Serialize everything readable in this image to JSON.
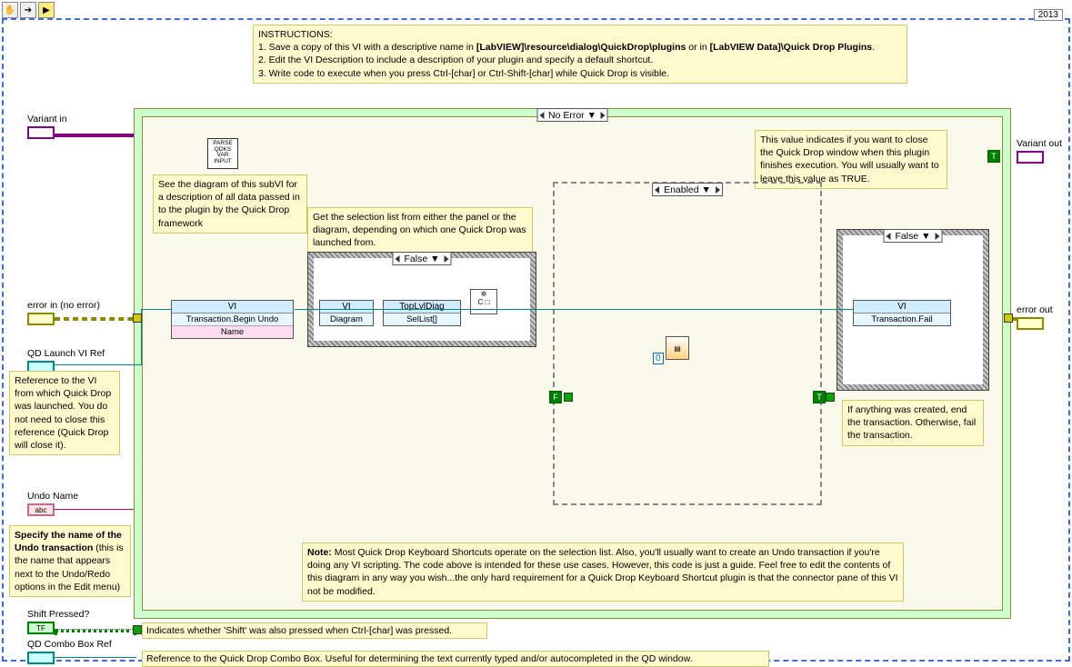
{
  "toolbar": {
    "hand": "✋",
    "arrow": "➔",
    "run": "▶"
  },
  "year": "2013",
  "instructions": {
    "heading": "INSTRUCTIONS:",
    "line1a": "1.  Save a copy of this VI with a descriptive name in ",
    "path1": "[LabVIEW]\\resource\\dialog\\QuickDrop\\plugins",
    "line1b": " or in ",
    "path2": "[LabVIEW Data]\\Quick Drop Plugins",
    "line2": "2.  Edit the VI Description to include a description of your plugin and specify a default shortcut.",
    "line3": "3.  Write code to execute when you press Ctrl-[char] or Ctrl-Shift-[char] while Quick Drop is visible."
  },
  "controls": {
    "variantIn": "Variant in",
    "variantOut": "Variant out",
    "errorIn": "error in (no error)",
    "errorOut": "error out",
    "qdLaunch": "QD Launch VI Ref",
    "undoName": "Undo Name",
    "shiftPressed": "Shift Pressed?",
    "qdCombo": "QD Combo Box Ref"
  },
  "comments": {
    "parseNote": "See the diagram of this subVI for a description of all data passed in to the plugin by the Quick Drop framework",
    "closeNote": "This value indicates if you want to close the Quick Drop window when this plugin finishes execution.  You will usually want to leave this value as TRUE.",
    "launchRef": "Reference to the VI from which Quick Drop was launched.  You do not need to close this reference (Quick Drop will close it).",
    "undoNote": {
      "bold": "Specify the name of the Undo transaction",
      "rest": " (this is the name that appears next to the Undo/Redo options in the Edit menu)"
    },
    "bottomNote": {
      "bold": "Note:",
      "rest": "  Most Quick Drop Keyboard Shortcuts operate on the selection list.  Also, you'll usually want to create an Undo transaction if you're doing any VI scripting.  The code above is intended for these use cases.  However, this code is just a guide.  Feel free to edit the contents of this diagram in any way you wish...the only hard requirement for a Quick Drop Keyboard Shortcut plugin is that the connector pane of this VI not be modified."
    },
    "selNote": "Get the selection list from either the panel or the diagram, depending on which one Quick Drop was launched from.",
    "failNote": "If anything was created, end the transaction. Otherwise, fail the transaction.",
    "shiftNote": "Indicates whether 'Shift' was also pressed when Ctrl-[char] was pressed.",
    "comboNote": "Reference to the Quick Drop Combo Box.  Useful for determining the text currently typed and/or autocompleted in the QD window."
  },
  "propNodes": {
    "begin": {
      "head": "VI",
      "row1": "Transaction.Begin Undo",
      "row2": "Name"
    },
    "diag": {
      "head": "VI",
      "row1": "Diagram"
    },
    "top": {
      "head": "TopLvlDiag",
      "row1": "SelList[]"
    },
    "fail": {
      "head": "VI",
      "row1": "Transaction.Fail"
    }
  },
  "selectors": {
    "noError": " No Error ▼",
    "enabled": " Enabled   ▼",
    "false": " False ▼",
    "false2": " False ▼"
  },
  "subvi": {
    "parse": "PARSE\nQDKS\nVAR\nINPUT"
  },
  "constants": {
    "zero": "0",
    "T": "T",
    "F": "F"
  }
}
